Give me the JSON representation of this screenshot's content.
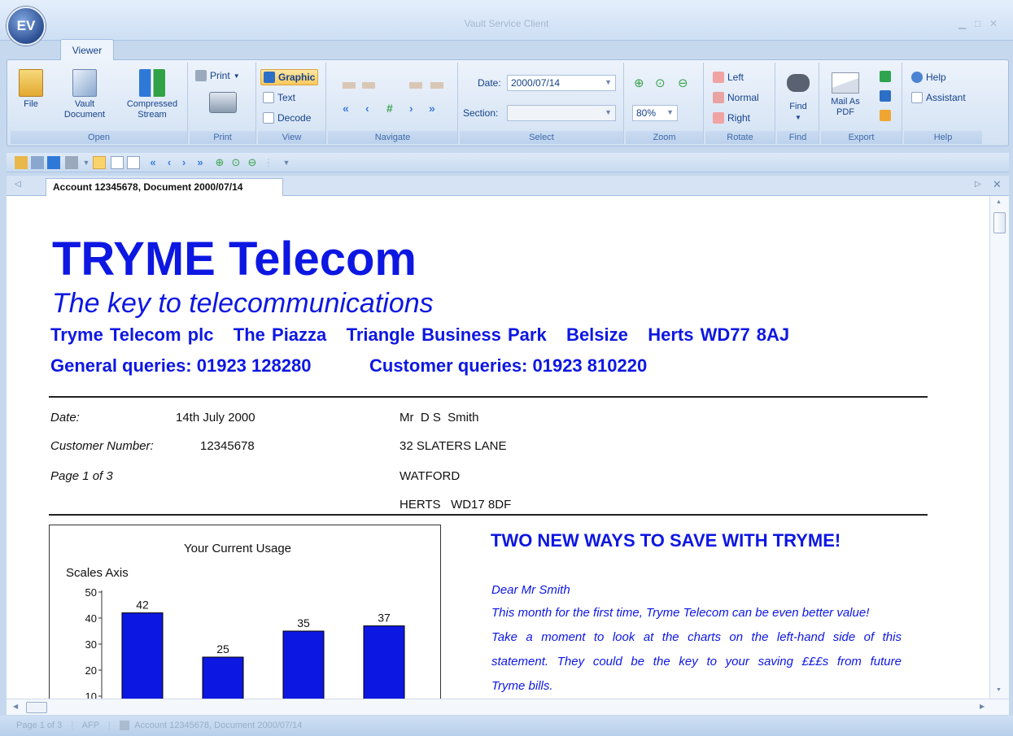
{
  "window": {
    "title": "Vault Service Client",
    "orb_label": "EV",
    "tab": "Viewer"
  },
  "ribbon": {
    "open": {
      "label": "Open",
      "file": "File",
      "vault_document": "Vault Document",
      "compressed_stream": "Compressed Stream"
    },
    "print": {
      "label": "Print",
      "print": "Print"
    },
    "view": {
      "label": "View",
      "graphic": "Graphic",
      "text": "Text",
      "decode": "Decode"
    },
    "navigate": {
      "label": "Navigate"
    },
    "select": {
      "label": "Select",
      "date_label": "Date:",
      "date_value": "2000/07/14",
      "section_label": "Section:",
      "section_value": ""
    },
    "zoom": {
      "label": "Zoom",
      "value": "80%"
    },
    "rotate": {
      "label": "Rotate",
      "left": "Left",
      "normal": "Normal",
      "right": "Right"
    },
    "find": {
      "label": "Find",
      "find": "Find"
    },
    "export": {
      "label": "Export",
      "mail_as_pdf": "Mail As PDF"
    },
    "help": {
      "label": "Help",
      "help": "Help",
      "assistant": "Assistant"
    }
  },
  "document_tab": {
    "label": "Account 12345678, Document 2000/07/14"
  },
  "statusbar": {
    "page": "Page 1 of 3",
    "mode": "AFP",
    "doc": "Account 12345678, Document 2000/07/14"
  },
  "document": {
    "brand": "TRYME Telecom",
    "tagline": "The key to telecommunications",
    "address": "Tryme Telecom plc   The Piazza   Triangle Business Park   Belsize   Herts WD77 8AJ",
    "general_queries": "General queries: 01923 128280",
    "customer_queries": "Customer queries: 01923 810220",
    "date_label": "Date:",
    "date_value": "14th July 2000",
    "customer_number_label": "Customer Number:",
    "customer_number_value": "12345678",
    "page_label": "Page 1 of 3",
    "recipient": [
      "Mr  D S  Smith",
      "32 SLATERS LANE",
      "WATFORD",
      "HERTS   WD17 8DF"
    ],
    "promo_title": "TWO NEW WAYS TO SAVE WITH TRYME!",
    "promo_lines": [
      "Dear Mr Smith",
      "This month for the first time, Tryme Telecom can be even better value!",
      "Take a moment to look at the charts on the left-hand side of this",
      "statement. They could be the key to your saving £££s from future",
      "Tryme bills."
    ]
  },
  "chart_data": {
    "type": "bar",
    "title": "Your Current Usage",
    "ylabel": "Scales Axis",
    "ylim": [
      0,
      50
    ],
    "yticks": [
      10,
      20,
      30,
      40,
      50
    ],
    "categories": [
      "",
      "",
      "",
      ""
    ],
    "values": [
      42,
      25,
      35,
      37
    ],
    "bar_color": "#0d17e2"
  },
  "colors": {
    "brand_blue": "#0d17e2",
    "ribbon_text": "#15428b"
  }
}
